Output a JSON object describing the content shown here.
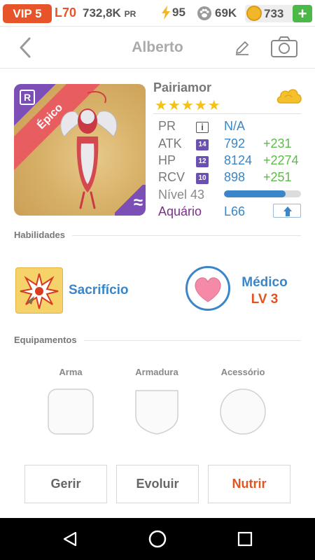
{
  "status": {
    "vip": "VIP 5",
    "level": "L70",
    "pr_value": "732,8K",
    "pr_unit": "PR",
    "energy": "95",
    "paw_count": "69K",
    "coins": "733",
    "plus": "+"
  },
  "header": {
    "title": "Alberto",
    "icons": {
      "back": "chevron-left-icon",
      "edit": "pencil-icon",
      "camera": "camera-icon"
    }
  },
  "pet": {
    "rarity": "Épico",
    "badge": "R",
    "element_symbol": "≈",
    "name": "Pairiamor",
    "stars_text": "★★★★★",
    "star_count": 5,
    "stats": [
      {
        "label": "PR",
        "icon": "i",
        "value": "N/A",
        "bonus": ""
      },
      {
        "label": "ATK",
        "icon": "14",
        "value": "792",
        "bonus": "+231"
      },
      {
        "label": "HP",
        "icon": "12",
        "value": "8124",
        "bonus": "+2274"
      },
      {
        "label": "RCV",
        "icon": "10",
        "value": "898",
        "bonus": "+251"
      }
    ],
    "level_label": "Nível 43",
    "level_progress": 0.8,
    "aquarium_label": "Aquário",
    "aquarium_level": "L66"
  },
  "sections": {
    "abilities": "Habilidades",
    "equipment": "Equipamentos"
  },
  "ability": {
    "skill_name": "Sacrifício",
    "role_name": "Médico",
    "role_level": "LV 3"
  },
  "equipment": {
    "slots": [
      "Arma",
      "Armadura",
      "Acessório"
    ]
  },
  "actions": {
    "manage": "Gerir",
    "evolve": "Evoluir",
    "feed": "Nutrir"
  },
  "colors": {
    "accent_blue": "#3a86c8",
    "accent_orange": "#e25420",
    "vip_red": "#e8542a",
    "bonus_green": "#5cbb4a",
    "rarity_purple": "#7b4fb5"
  }
}
